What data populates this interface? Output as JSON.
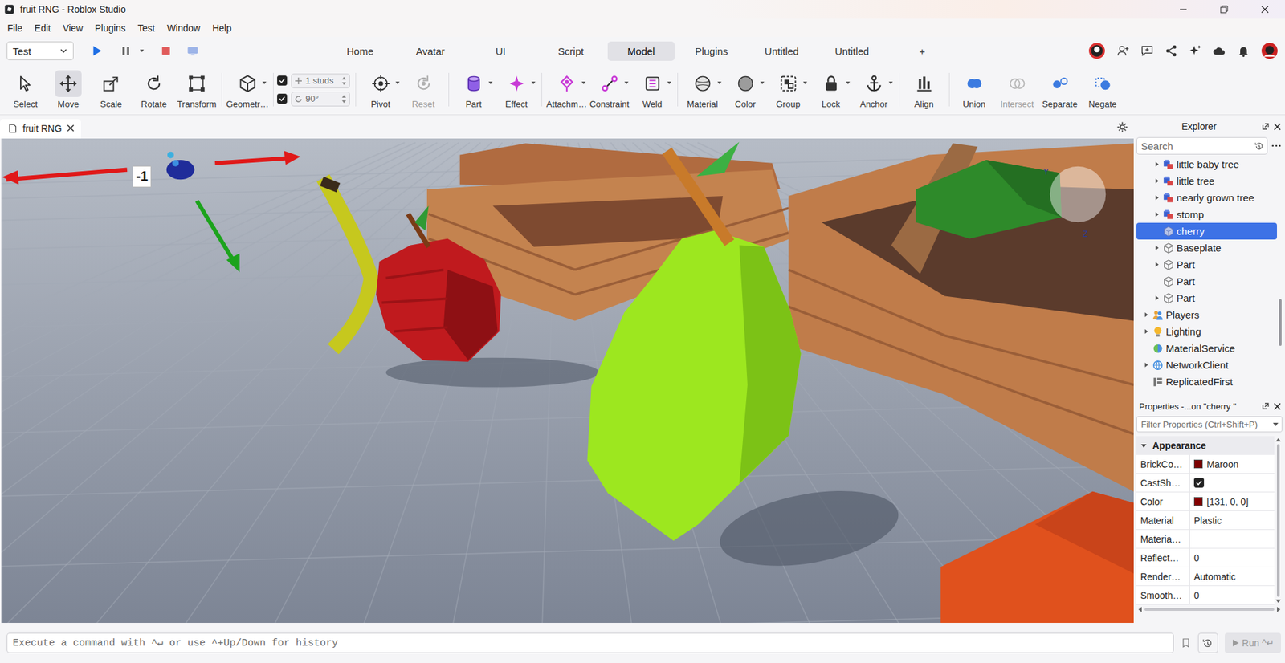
{
  "window": {
    "title": "fruit RNG - Roblox Studio"
  },
  "menu": [
    "File",
    "Edit",
    "View",
    "Plugins",
    "Test",
    "Window",
    "Help"
  ],
  "mode": {
    "value": "Test"
  },
  "tabs": [
    {
      "label": "Home",
      "selected": false
    },
    {
      "label": "Avatar",
      "selected": false
    },
    {
      "label": "UI",
      "selected": false
    },
    {
      "label": "Script",
      "selected": false
    },
    {
      "label": "Model",
      "selected": true
    },
    {
      "label": "Plugins",
      "selected": false
    },
    {
      "label": "Untitled",
      "selected": false
    },
    {
      "label": "Untitled",
      "selected": false
    },
    {
      "label": "+",
      "selected": false
    }
  ],
  "tools": [
    {
      "label": "Select",
      "group": 1,
      "selected": false,
      "disabled": false,
      "dropdown": false
    },
    {
      "label": "Move",
      "group": 1,
      "selected": true,
      "disabled": false,
      "dropdown": false
    },
    {
      "label": "Scale",
      "group": 1,
      "selected": false,
      "disabled": false,
      "dropdown": false
    },
    {
      "label": "Rotate",
      "group": 1,
      "selected": false,
      "disabled": false,
      "dropdown": false
    },
    {
      "label": "Transform",
      "group": 1,
      "selected": false,
      "disabled": false,
      "dropdown": false
    },
    {
      "label": "Geometr…",
      "group": 2,
      "selected": false,
      "disabled": false,
      "dropdown": true
    },
    {
      "label": "Pivot",
      "group": 3,
      "selected": false,
      "disabled": false,
      "dropdown": true
    },
    {
      "label": "Reset",
      "group": 3,
      "selected": false,
      "disabled": true,
      "dropdown": false
    },
    {
      "label": "Part",
      "group": 4,
      "selected": false,
      "disabled": false,
      "dropdown": true
    },
    {
      "label": "Effect",
      "group": 4,
      "selected": false,
      "disabled": false,
      "dropdown": true
    },
    {
      "label": "Attachm…",
      "group": 5,
      "selected": false,
      "disabled": false,
      "dropdown": true
    },
    {
      "label": "Constraint",
      "group": 5,
      "selected": false,
      "disabled": false,
      "dropdown": true
    },
    {
      "label": "Weld",
      "group": 5,
      "selected": false,
      "disabled": false,
      "dropdown": true
    },
    {
      "label": "Material",
      "group": 6,
      "selected": false,
      "disabled": false,
      "dropdown": true
    },
    {
      "label": "Color",
      "group": 6,
      "selected": false,
      "disabled": false,
      "dropdown": true
    },
    {
      "label": "Group",
      "group": 6,
      "selected": false,
      "disabled": false,
      "dropdown": true
    },
    {
      "label": "Lock",
      "group": 6,
      "selected": false,
      "disabled": false,
      "dropdown": true
    },
    {
      "label": "Anchor",
      "group": 6,
      "selected": false,
      "disabled": false,
      "dropdown": true
    },
    {
      "label": "Align",
      "group": 7,
      "selected": false,
      "disabled": false,
      "dropdown": false
    },
    {
      "label": "Union",
      "group": 8,
      "selected": false,
      "disabled": false,
      "dropdown": false
    },
    {
      "label": "Intersect",
      "group": 8,
      "selected": false,
      "disabled": true,
      "dropdown": false
    },
    {
      "label": "Separate",
      "group": 8,
      "selected": false,
      "disabled": false,
      "dropdown": false
    },
    {
      "label": "Negate",
      "group": 8,
      "selected": false,
      "disabled": false,
      "dropdown": false
    }
  ],
  "snap": [
    {
      "checked": true,
      "value": "1 studs"
    },
    {
      "checked": true,
      "value": "90°"
    }
  ],
  "doc_tab": {
    "label": "fruit RNG"
  },
  "viewport": {
    "gizmo_label": "-1",
    "axes": [
      "Y",
      "Z"
    ]
  },
  "explorer": {
    "title": "Explorer",
    "search": {
      "placeholder": "Search"
    },
    "items": [
      {
        "label": "little baby tree",
        "depth": 1,
        "kind": "model",
        "has_children": true,
        "expanded": false,
        "selected": false
      },
      {
        "label": "little tree",
        "depth": 1,
        "kind": "model",
        "has_children": true,
        "expanded": false,
        "selected": false
      },
      {
        "label": "nearly grown tree",
        "depth": 1,
        "kind": "model",
        "has_children": true,
        "expanded": false,
        "selected": false
      },
      {
        "label": "stomp",
        "depth": 1,
        "kind": "model",
        "has_children": true,
        "expanded": false,
        "selected": false
      },
      {
        "label": "cherry",
        "depth": 1,
        "kind": "meshpart",
        "has_children": false,
        "expanded": false,
        "selected": true
      },
      {
        "label": "Baseplate",
        "depth": 1,
        "kind": "part",
        "has_children": true,
        "expanded": false,
        "selected": false
      },
      {
        "label": "Part",
        "depth": 1,
        "kind": "part",
        "has_children": true,
        "expanded": false,
        "selected": false
      },
      {
        "label": "Part",
        "depth": 1,
        "kind": "part",
        "has_children": false,
        "expanded": false,
        "selected": false
      },
      {
        "label": "Part",
        "depth": 1,
        "kind": "part",
        "has_children": true,
        "expanded": false,
        "selected": false
      },
      {
        "label": "Players",
        "depth": 0,
        "kind": "players",
        "has_children": true,
        "expanded": false,
        "selected": false
      },
      {
        "label": "Lighting",
        "depth": 0,
        "kind": "lighting",
        "has_children": true,
        "expanded": false,
        "selected": false
      },
      {
        "label": "MaterialService",
        "depth": 0,
        "kind": "service",
        "has_children": false,
        "expanded": false,
        "selected": false
      },
      {
        "label": "NetworkClient",
        "depth": 0,
        "kind": "network",
        "has_children": true,
        "expanded": false,
        "selected": false
      },
      {
        "label": "ReplicatedFirst",
        "depth": 0,
        "kind": "replicated",
        "has_children": false,
        "expanded": false,
        "selected": false
      }
    ]
  },
  "properties": {
    "title": "Properties -...on \"cherry \"",
    "filter": {
      "placeholder": "Filter Properties (Ctrl+Shift+P)"
    },
    "category": {
      "label": "Appearance",
      "expanded": true
    },
    "rows": [
      {
        "name": "BrickCo…",
        "kind": "color",
        "value": "Maroon",
        "color": "#7b0000"
      },
      {
        "name": "CastSh…",
        "kind": "checkbox",
        "checked": true
      },
      {
        "name": "Color",
        "kind": "color",
        "value": "[131, 0, 0]",
        "color": "#830000"
      },
      {
        "name": "Material",
        "kind": "text",
        "value": "Plastic"
      },
      {
        "name": "Materia…",
        "kind": "empty"
      },
      {
        "name": "Reflect…",
        "kind": "text",
        "value": "0"
      },
      {
        "name": "Render…",
        "kind": "text",
        "value": "Automatic"
      },
      {
        "name": "Smooth…",
        "kind": "text",
        "value": "0"
      }
    ]
  },
  "command_bar": {
    "placeholder": "Execute a command with ^↵ or use ^+Up/Down for history",
    "run": "Run ^↵"
  }
}
